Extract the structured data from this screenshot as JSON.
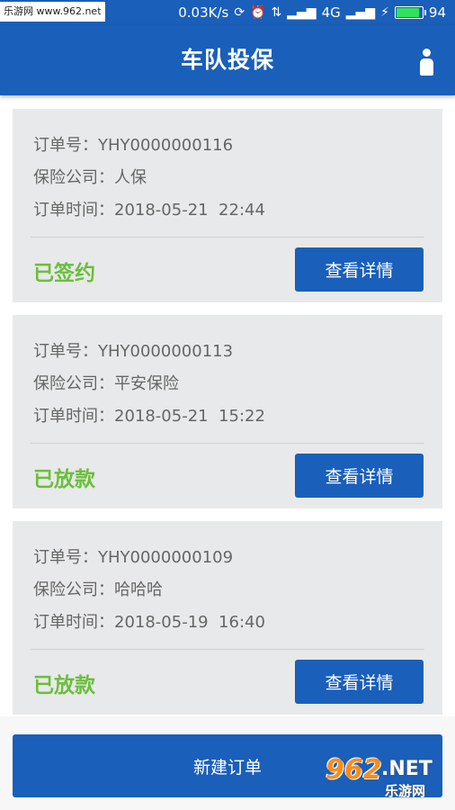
{
  "status_bar": {
    "watermark": "乐游网 www.962.net",
    "network_speed": "0.03K/s",
    "network_type": "4G",
    "battery_level": "94",
    "battery_fraction": 0.94,
    "battery_color": "#2ee35a"
  },
  "header": {
    "title": "车队投保",
    "profile_icon": "person-icon"
  },
  "orders": [
    {
      "order_no": "订单号：YHY0000000116",
      "company": "保险公司：人保",
      "time": "订单时间：2018-05-21  22:44",
      "status": "已签约",
      "detail_label": "查看详情"
    },
    {
      "order_no": "订单号：YHY0000000113",
      "company": "保险公司：平安保险",
      "time": "订单时间：2018-05-21  15:22",
      "status": "已放款",
      "detail_label": "查看详情"
    },
    {
      "order_no": "订单号：YHY0000000109",
      "company": "保险公司：哈哈哈",
      "time": "订单时间：2018-05-19  16:40",
      "status": "已放款",
      "detail_label": "查看详情"
    }
  ],
  "footer": {
    "new_order_label": "新建订单"
  },
  "watermark_br": {
    "number": "962",
    "suffix": ".NET",
    "cn": "乐游网"
  },
  "colors": {
    "primary": "#1a5fba",
    "status_green": "#6abf3b",
    "card_bg": "#e8e9ea"
  }
}
